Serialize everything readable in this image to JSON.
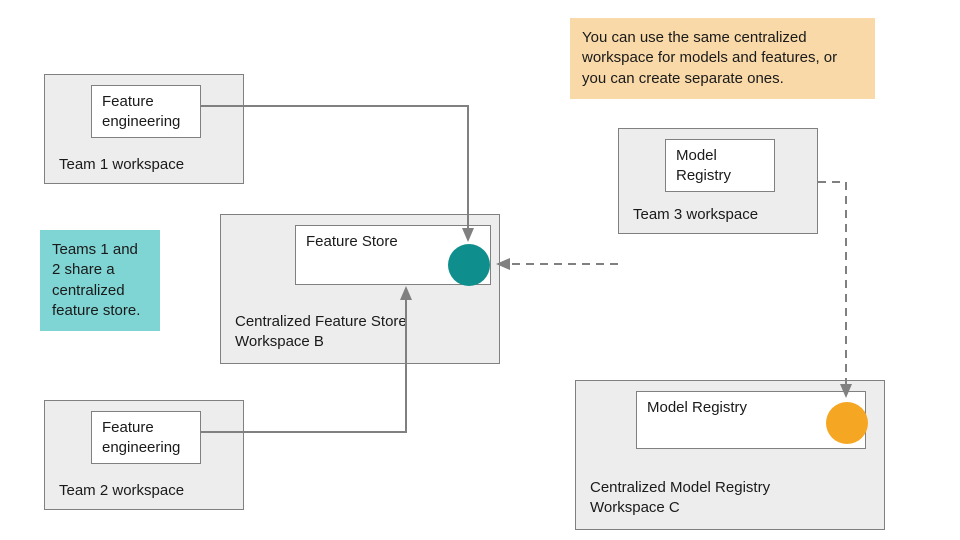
{
  "notes": {
    "orange": "You can use the same centralized workspace for models and features, or you can create separate ones.",
    "teal": "Teams 1 and 2 share a centralized feature store."
  },
  "workspaces": {
    "team1": {
      "label": "Team 1 workspace",
      "inner": "Feature engineering"
    },
    "team2": {
      "label": "Team 2 workspace",
      "inner": "Feature engineering"
    },
    "team3": {
      "label": "Team 3 workspace",
      "inner": "Model Registry"
    },
    "featureStore": {
      "label": "Centralized Feature Store Workspace B",
      "inner": "Feature Store"
    },
    "modelRegistry": {
      "label": "Centralized Model Registry Workspace C",
      "inner": "Model Registry"
    }
  },
  "icons": {
    "featureStore": "feature-store-circle",
    "modelRegistry": "model-registry-circle"
  },
  "colors": {
    "teal": "#0f8e8e",
    "orange": "#f5a623",
    "noteTeal": "#7fd4d4",
    "noteOrange": "#f9d9a8",
    "boxFill": "#ededed",
    "border": "#808080",
    "arrow": "#808080"
  }
}
